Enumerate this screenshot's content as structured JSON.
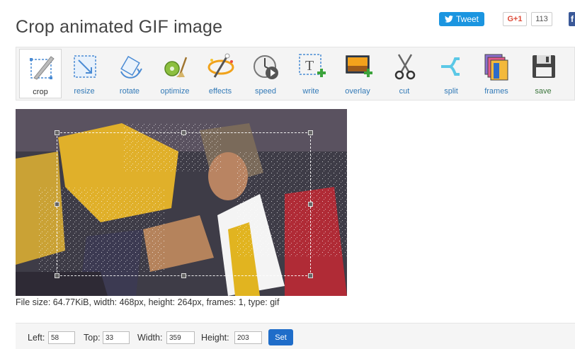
{
  "page": {
    "title": "Crop animated GIF image"
  },
  "share": {
    "tweet_label": "Tweet",
    "gplus_label": "G+1",
    "gplus_count": "113",
    "fb_label": "f"
  },
  "toolbar": {
    "items": [
      {
        "label": "crop",
        "icon": "crop-icon",
        "active": true
      },
      {
        "label": "resize",
        "icon": "resize-icon"
      },
      {
        "label": "rotate",
        "icon": "rotate-icon"
      },
      {
        "label": "optimize",
        "icon": "optimize-icon"
      },
      {
        "label": "effects",
        "icon": "effects-icon"
      },
      {
        "label": "speed",
        "icon": "speed-icon"
      },
      {
        "label": "write",
        "icon": "write-icon"
      },
      {
        "label": "overlay",
        "icon": "overlay-icon"
      },
      {
        "label": "cut",
        "icon": "scissors-icon"
      },
      {
        "label": "split",
        "icon": "split-icon"
      },
      {
        "label": "frames",
        "icon": "frames-icon"
      },
      {
        "label": "save",
        "icon": "floppy-disk-icon"
      }
    ]
  },
  "image_info": "File size: 64.77KiB, width: 468px, height: 264px, frames: 1, type: gif",
  "crop_form": {
    "left_label": "Left:",
    "left_value": "58",
    "top_label": "Top:",
    "top_value": "33",
    "width_label": "Width:",
    "width_value": "359",
    "height_label": "Height:",
    "height_value": "203",
    "set_label": "Set"
  },
  "colors": {
    "accent": "#337ab7",
    "tweet": "#1b95e0",
    "set_button": "#1f6dc9",
    "save": "#3c763d"
  }
}
